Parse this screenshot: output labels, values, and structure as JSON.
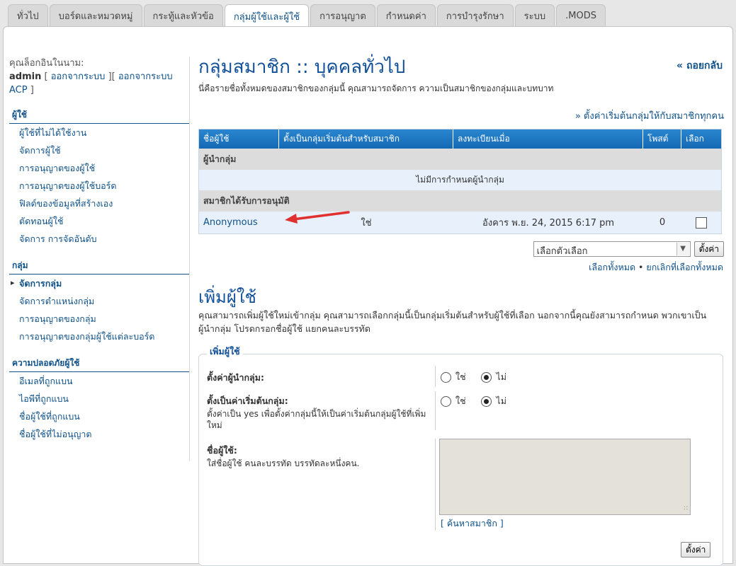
{
  "tabs": [
    "ทั่วไป",
    "บอร์ดและหมวดหมู่",
    "กระทู้และหัวข้อ",
    "กลุ่มผู้ใช้และผู้ใช้",
    "การอนุญาต",
    "กำหนดค่า",
    "การบำรุงรักษา",
    "ระบบ",
    ".MODS"
  ],
  "sidebar": {
    "login_prefix": "คุณล็อกอินในนาม:",
    "username": "admin",
    "logout": "ออกจากระบบ",
    "logout_acp": "ออกจากระบบ ACP",
    "sections": [
      {
        "title": "ผู้ใช้",
        "items": [
          "ผู้ใช้ที่ไม่ได้ใช้งาน",
          "จัดการผู้ใช้",
          "การอนุญาตของผู้ใช้",
          "การอนุญาตของผู้ใช้บอร์ด",
          "ฟิลด์ของข้อมูลที่สร้างเอง",
          "ตัดทอนผู้ใช้",
          "จัดการ การจัดอันดับ"
        ]
      },
      {
        "title": "กลุ่ม",
        "items": [
          "จัดการกลุ่ม",
          "จัดการตำแหน่งกลุ่ม",
          "การอนุญาตของกลุ่ม",
          "การอนุญาตของกลุ่มผู้ใช้แต่ละบอร์ด"
        ]
      },
      {
        "title": "ความปลอดภัยผู้ใช้",
        "items": [
          "อีเมลที่ถูกแบน",
          "ไอพีที่ถูกแบน",
          "ชื่อผู้ใช้ที่ถูกแบน",
          "ชื่อผู้ใช้ที่ไม่อนุญาต"
        ]
      }
    ]
  },
  "main": {
    "title": "กลุ่มสมาชิก :: บุคคลทั่วไป",
    "back": "« ถอยกลับ",
    "intro": "นี่คือรายชื่อทั้งหมดของสมาชิกของกลุ่มนี้ คุณสามารถจัดการ ความเป็นสมาชิกของกลุ่มและบทบาท",
    "default_all": "» ตั้งค่าเริ่มต้นกลุ่มให้กับสมาชิกทุกคน",
    "table": {
      "headers": [
        "ชื่อผู้ใช้",
        "ตั้งเป็นกลุ่มเริ่มต้นสำหรับสมาชิก",
        "ลงทะเบียนเมื่อ",
        "โพสต์",
        "เลือก"
      ],
      "leaders_heading": "ผู้นำกลุ่ม",
      "no_leaders": "ไม่มีการกำหนดผู้นำกลุ่ม",
      "approved_heading": "สมาชิกได้รับการอนุมัติ",
      "rows": [
        {
          "username": "Anonymous",
          "default": "ใช่",
          "joined": "อังคาร พ.ย. 24, 2015 6:17 pm",
          "posts": "0"
        }
      ]
    },
    "select_option": "เลือกตัวเลือก",
    "submit": "ตั้งค่า",
    "mark_all": "เลือกทั้งหมด",
    "unmark_all": "ยกเลิกที่เลือกทั้งหมด"
  },
  "add": {
    "title": "เพิ่มผู้ใช้",
    "desc": "คุณสามารถเพิ่มผู้ใช้ใหม่เข้ากลุ่ม คุณสามารถเลือกกลุ่มนี้เป็นกลุ่มเริ่มต้นสำหรับผู้ใช้ที่เลือก นอกจากนี้คุณยังสามารถกำหนด พวกเขาเป็นผู้นำกลุ่ม โปรดกรอกชื่อผู้ใช้ แยกคนละบรรทัด",
    "legend": "เพิ่มผู้ใช้",
    "leader_label": "ตั้งค่าผู้นำกลุ่ม:",
    "default_label": "ตั้งเป็นค่าเริ่มต้นกลุ่ม:",
    "default_help": "ตั้งค่าเป็น yes เพื่อตั้งค่ากลุ่มนี้ให้เป็นค่าเริ่มต้นกลุ่มผู้ใช้ที่เพิ่มใหม่",
    "yes": "ใช่",
    "no": "ไม่",
    "users_label": "ชื่อผู้ใช้:",
    "users_help": "ใส่ชื่อผู้ใช้ คนละบรรทัด บรรทัดละหนึ่งคน.",
    "find_member": "[ ค้นหาสมาชิก ]",
    "submit": "ตั้งค่า"
  }
}
